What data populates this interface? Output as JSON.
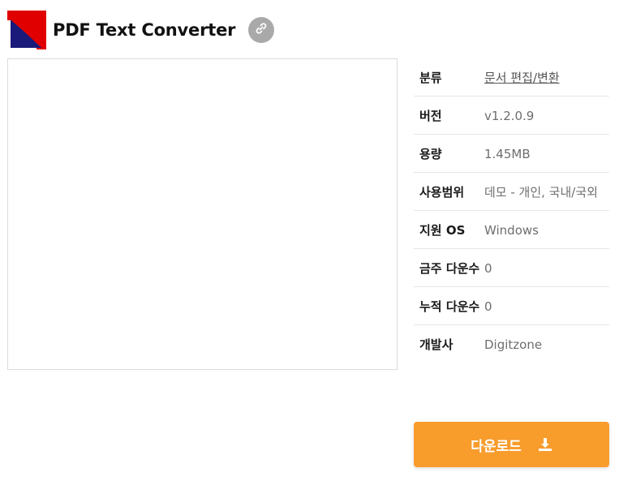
{
  "app": {
    "title": "PDF Text Converter",
    "logo_icon": "app-logo-icon",
    "link_icon": "link-icon"
  },
  "info": {
    "rows": [
      {
        "label": "분류",
        "value": "문서 편집/변환"
      },
      {
        "label": "버전",
        "value": "v1.2.0.9"
      },
      {
        "label": "용량",
        "value": "1.45MB"
      },
      {
        "label": "사용범위",
        "value": "데모 - 개인, 국내/국외"
      },
      {
        "label": "지원 OS",
        "value": "Windows"
      },
      {
        "label": "금주 다운수",
        "value": "0"
      },
      {
        "label": "누적 다운수",
        "value": "0"
      },
      {
        "label": "개발사",
        "value": "Digitzone"
      }
    ]
  },
  "download": {
    "label": "다운로드",
    "icon": "download-icon"
  },
  "colors": {
    "accent": "#f89c2c",
    "link_button": "#a9a9a9",
    "logo_red": "#e00000",
    "logo_navy": "#1a1a7a"
  }
}
